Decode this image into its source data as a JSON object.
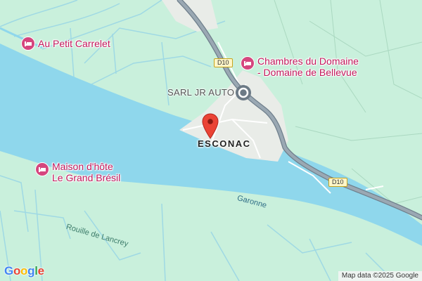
{
  "map": {
    "colors": {
      "land": "#c9f0dc",
      "water": "#8fd7ec",
      "road_major": "#8a9aa7",
      "road_outline": "#6f7f8c",
      "poi": "#c2185b",
      "pin": "#ea4335"
    },
    "pois": [
      {
        "name": "Au Petit Carrelet",
        "icon": "bed-icon"
      },
      {
        "name": "Chambres du Domaine",
        "name2": "- Domaine de Bellevue",
        "icon": "bed-icon"
      },
      {
        "name": "Maison d'hôte",
        "name2": "Le Grand Brésil",
        "icon": "bed-icon"
      }
    ],
    "business": {
      "name": "SARL JR AUTO",
      "icon": "circle-marker-icon"
    },
    "place": {
      "name": "ESCONAC",
      "icon": "location-pin-icon"
    },
    "roads": [
      {
        "ref": "D10"
      },
      {
        "ref": "D10"
      }
    ],
    "waterways": {
      "river": "Garonne",
      "stream": "Rouille de Lancrey"
    },
    "attribution": "Map data ©2025 Google",
    "logo": {
      "letters": [
        "G",
        "o",
        "o",
        "g",
        "l",
        "e"
      ],
      "colors": [
        "#4285F4",
        "#EA4335",
        "#FBBC05",
        "#4285F4",
        "#34A853",
        "#EA4335"
      ]
    }
  }
}
